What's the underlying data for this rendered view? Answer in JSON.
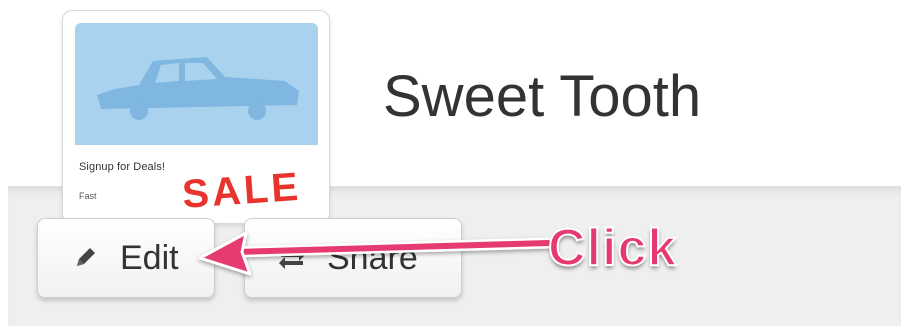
{
  "thumbnail": {
    "caption": "Signup for Deals!",
    "small_text": "Fast",
    "promo_text": "SALE"
  },
  "title": "Sweet Tooth",
  "actions": {
    "edit_label": "Edit",
    "share_label": "Share"
  },
  "annotation": {
    "label": "Click",
    "color": "#e53a6f"
  },
  "icons": {
    "edit": "pencil-icon",
    "share": "share-arrows-icon"
  }
}
